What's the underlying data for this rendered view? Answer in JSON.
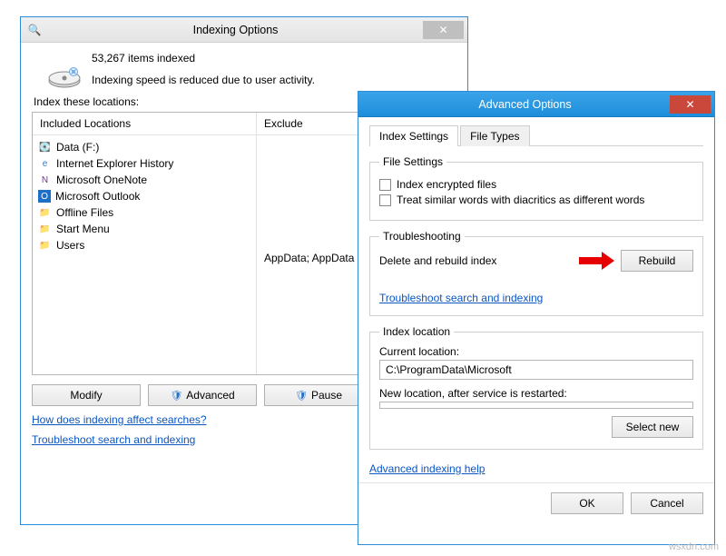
{
  "indexing": {
    "title": "Indexing Options",
    "indexed_count": "53,267 items indexed",
    "speed_note": "Indexing speed is reduced due to user activity.",
    "locations_label": "Index these locations:",
    "col_included": "Included Locations",
    "col_exclude": "Exclude",
    "items": [
      {
        "label": "Data (F:)"
      },
      {
        "label": "Internet Explorer History"
      },
      {
        "label": "Microsoft OneNote"
      },
      {
        "label": "Microsoft Outlook"
      },
      {
        "label": "Offline Files"
      },
      {
        "label": "Start Menu"
      },
      {
        "label": "Users"
      }
    ],
    "exclude_value": "AppData; AppData",
    "btn_modify": "Modify",
    "btn_advanced": "Advanced",
    "btn_pause": "Pause",
    "link_affect": "How does indexing affect searches?",
    "link_trouble": "Troubleshoot search and indexing"
  },
  "advanced": {
    "title": "Advanced Options",
    "tab_settings": "Index Settings",
    "tab_filetypes": "File Types",
    "fs_filesettings": "File Settings",
    "chk_encrypted": "Index encrypted files",
    "chk_diacritics": "Treat similar words with diacritics as different words",
    "fs_trouble": "Troubleshooting",
    "lbl_rebuild": "Delete and rebuild index",
    "btn_rebuild": "Rebuild",
    "link_trouble": "Troubleshoot search and indexing",
    "fs_location": "Index location",
    "lbl_current": "Current location:",
    "current_path": "C:\\ProgramData\\Microsoft",
    "lbl_new": "New location, after service is restarted:",
    "new_path": "",
    "btn_selectnew": "Select new",
    "link_help": "Advanced indexing help",
    "btn_ok": "OK",
    "btn_cancel": "Cancel"
  },
  "watermark": "wsxdn.com"
}
